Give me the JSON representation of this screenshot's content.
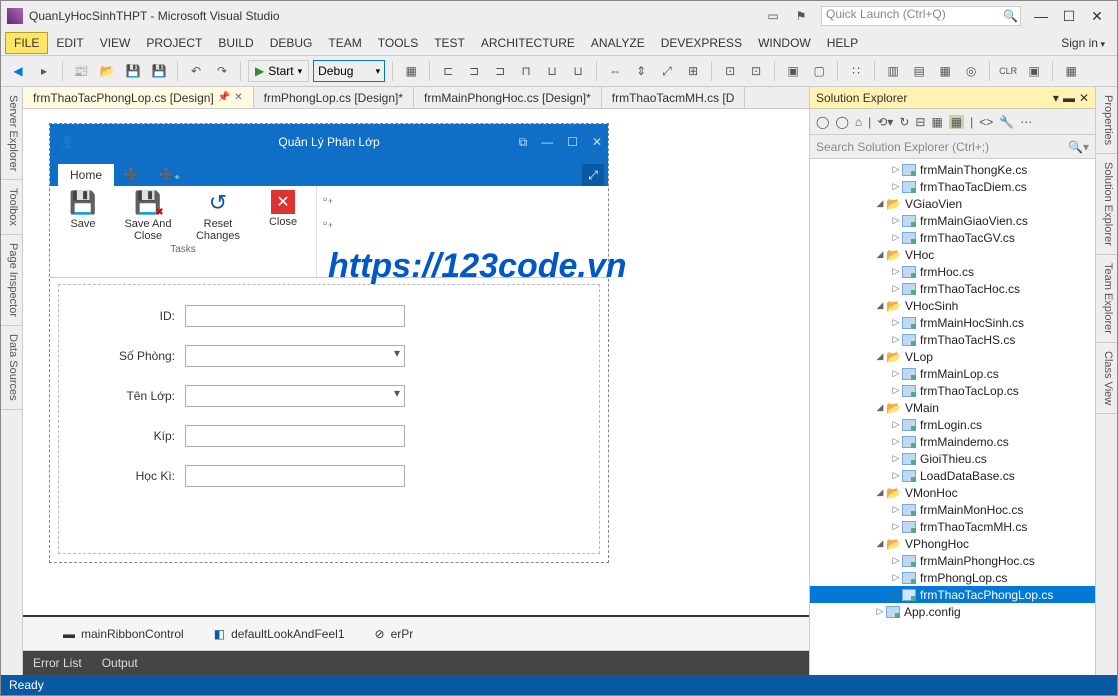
{
  "titlebar": {
    "title": "QuanLyHocSinhTHPT - Microsoft Visual Studio",
    "quick_placeholder": "Quick Launch (Ctrl+Q)"
  },
  "menu": {
    "items": [
      "FILE",
      "EDIT",
      "VIEW",
      "PROJECT",
      "BUILD",
      "DEBUG",
      "TEAM",
      "TOOLS",
      "TEST",
      "ARCHITECTURE",
      "ANALYZE",
      "DEVEXPRESS",
      "WINDOW",
      "HELP"
    ],
    "signin": "Sign in"
  },
  "toolbar": {
    "start": "Start",
    "config": "Debug"
  },
  "leftrail": [
    "Server Explorer",
    "Toolbox",
    "Page Inspector",
    "Data Sources"
  ],
  "rightrail": [
    "Properties",
    "Solution Explorer",
    "Team Explorer",
    "Class View"
  ],
  "doctabs": {
    "active": "frmThaoTacPhongLop.cs [Design]",
    "others": [
      "frmPhongLop.cs [Design]*",
      "frmMainPhongHoc.cs [Design]*",
      "frmThaoTacmMH.cs [D"
    ]
  },
  "form": {
    "title": "Quản Lý Phân Lớp",
    "hometab": "Home",
    "group_tasks": "Tasks",
    "save": "Save",
    "saveclose": "Save And Close",
    "reset": "Reset Changes",
    "close": "Close",
    "lbl_id": "ID:",
    "lbl_sophong": "Số Phòng:",
    "lbl_tenlop": "Tên Lớp:",
    "lbl_kip": "Kíp:",
    "lbl_hocki": "Học Kì:"
  },
  "watermark": "https://123code.vn",
  "tray": {
    "c1": "mainRibbonControl",
    "c2": "defaultLookAndFeel1",
    "c3": "erPr"
  },
  "bottomtabs": {
    "t1": "Error List",
    "t2": "Output"
  },
  "solexp": {
    "title": "Solution Explorer",
    "search_placeholder": "Search Solution Explorer (Ctrl+;)",
    "tree": [
      {
        "d": 2,
        "t": "cs",
        "e": "r",
        "n": "frmMainThongKe.cs"
      },
      {
        "d": 2,
        "t": "cs",
        "e": "r",
        "n": "frmThaoTacDiem.cs"
      },
      {
        "d": 1,
        "t": "fo",
        "e": "d",
        "n": "VGiaoVien"
      },
      {
        "d": 2,
        "t": "cs",
        "e": "r",
        "n": "frmMainGiaoVien.cs"
      },
      {
        "d": 2,
        "t": "cs",
        "e": "r",
        "n": "frmThaoTacGV.cs"
      },
      {
        "d": 1,
        "t": "fo",
        "e": "d",
        "n": "VHoc"
      },
      {
        "d": 2,
        "t": "cs",
        "e": "r",
        "n": "frmHoc.cs"
      },
      {
        "d": 2,
        "t": "cs",
        "e": "r",
        "n": "frmThaoTacHoc.cs"
      },
      {
        "d": 1,
        "t": "fo",
        "e": "d",
        "n": "VHocSinh"
      },
      {
        "d": 2,
        "t": "cs",
        "e": "r",
        "n": "frmMainHocSinh.cs"
      },
      {
        "d": 2,
        "t": "cs",
        "e": "r",
        "n": "frmThaoTacHS.cs"
      },
      {
        "d": 1,
        "t": "fo",
        "e": "d",
        "n": "VLop"
      },
      {
        "d": 2,
        "t": "cs",
        "e": "r",
        "n": "frmMainLop.cs"
      },
      {
        "d": 2,
        "t": "cs",
        "e": "r",
        "n": "frmThaoTacLop.cs"
      },
      {
        "d": 1,
        "t": "fo",
        "e": "d",
        "n": "VMain"
      },
      {
        "d": 2,
        "t": "cs",
        "e": "r",
        "n": "frmLogin.cs"
      },
      {
        "d": 2,
        "t": "cs",
        "e": "r",
        "n": "frmMaindemo.cs"
      },
      {
        "d": 2,
        "t": "cs",
        "e": "r",
        "n": "GioiThieu.cs"
      },
      {
        "d": 2,
        "t": "cs",
        "e": "r",
        "n": "LoadDataBase.cs"
      },
      {
        "d": 1,
        "t": "fo",
        "e": "d",
        "n": "VMonHoc"
      },
      {
        "d": 2,
        "t": "cs",
        "e": "r",
        "n": "frmMainMonHoc.cs"
      },
      {
        "d": 2,
        "t": "cs",
        "e": "r",
        "n": "frmThaoTacmMH.cs"
      },
      {
        "d": 1,
        "t": "fo",
        "e": "d",
        "n": "VPhongHoc"
      },
      {
        "d": 2,
        "t": "cs",
        "e": "r",
        "n": "frmMainPhongHoc.cs"
      },
      {
        "d": 2,
        "t": "cs",
        "e": "r",
        "n": "frmPhongLop.cs"
      },
      {
        "d": 2,
        "t": "cs",
        "e": "r",
        "n": "frmThaoTacPhongLop.cs",
        "sel": true
      },
      {
        "d": 1,
        "t": "cs",
        "e": "r",
        "n": "App.config"
      }
    ]
  },
  "status": "Ready"
}
